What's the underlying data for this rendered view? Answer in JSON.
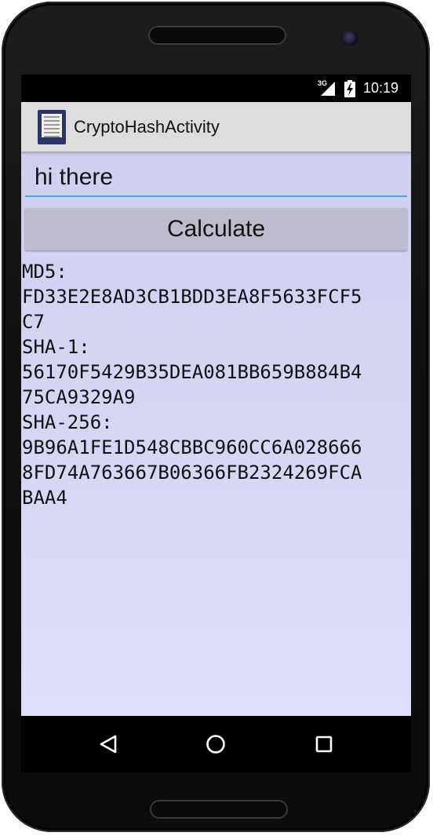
{
  "status_bar": {
    "network_type": "3G",
    "time": "10:19",
    "icons": [
      "signal-icon",
      "battery-charging-icon"
    ]
  },
  "action_bar": {
    "title": "CryptoHashActivity",
    "icon": "app-launcher-icon"
  },
  "form": {
    "input_value": "hi there",
    "calculate_label": "Calculate"
  },
  "output": {
    "lines": [
      "MD5:",
      "FD33E2E8AD3CB1BDD3EA8F5633FCF5",
      "C7",
      "SHA-1:",
      "56170F5429B35DEA081BB659B884B4",
      "75CA9329A9",
      "SHA-256:",
      "9B96A1FE1D548CBBC960CC6A028666",
      "8FD74A763667B06366FB2324269FCA",
      "BAA4"
    ]
  },
  "nav_bar": {
    "buttons": [
      "back-icon",
      "home-icon",
      "recents-icon"
    ]
  },
  "colors": {
    "input_underline": "#3fa9e0",
    "content_background": "#d6d6f4",
    "action_bar": "#dddddd",
    "button": "#bcbccc"
  }
}
